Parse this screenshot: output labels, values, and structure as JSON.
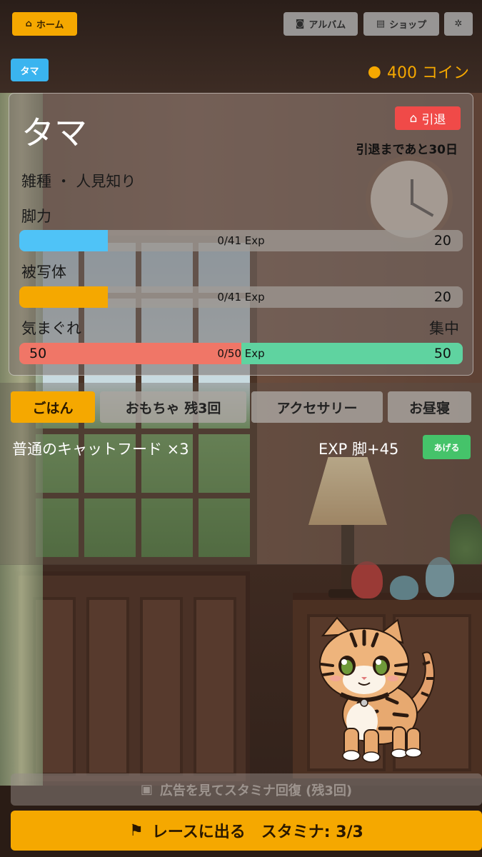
{
  "topbar": {
    "home_label": "ホーム",
    "album_label": "アルバム",
    "shop_label": "ショップ",
    "home_icon": "house-icon",
    "album_icon": "camera-icon",
    "shop_icon": "cart-icon",
    "settings_icon": "gear-icon"
  },
  "pet_tag": "タマ",
  "coins": {
    "amount_label": "400 コイン",
    "icon": "money-bag-icon"
  },
  "status": {
    "name": "タマ",
    "retire_label": "引退",
    "retire_icon": "house-icon",
    "retire_left": "引退まであと30日",
    "traits": "雑種 ・ 人見知り",
    "stats": [
      {
        "label": "脚力",
        "exp": "0/41 Exp",
        "value": "20",
        "fill_fraction": 0.2,
        "color": "#4fc3f7"
      },
      {
        "label": "被写体",
        "exp": "0/41 Exp",
        "value": "20",
        "fill_fraction": 0.2,
        "color": "#f5a800"
      }
    ],
    "mood": {
      "left_label": "気まぐれ",
      "right_label": "集中",
      "exp": "0/50 Exp",
      "left_value": "50",
      "right_value": "50",
      "left_fraction": 0.5,
      "left_color": "#f07667",
      "right_color": "#5fd3a0"
    }
  },
  "tabs": [
    {
      "label": "ごはん",
      "active": true
    },
    {
      "label": "おもちゃ 残3回",
      "active": false
    },
    {
      "label": "アクセサリー",
      "active": false
    },
    {
      "label": "お昼寝",
      "active": false
    }
  ],
  "food_item": {
    "name": "普通のキャットフード ×3",
    "effect": "EXP 脚+45",
    "give_label": "あげる"
  },
  "ad_button": {
    "label": "広告を見てスタミナ回復 (残3回)",
    "icon": "tv-icon"
  },
  "race_button": {
    "label": "レースに出る　スタミナ: 3/3",
    "icon": "checkered-flag-icon"
  },
  "colors": {
    "accent": "#f5a800",
    "danger": "#f04a48",
    "success": "#45c36a",
    "info": "#3ab4ef"
  }
}
